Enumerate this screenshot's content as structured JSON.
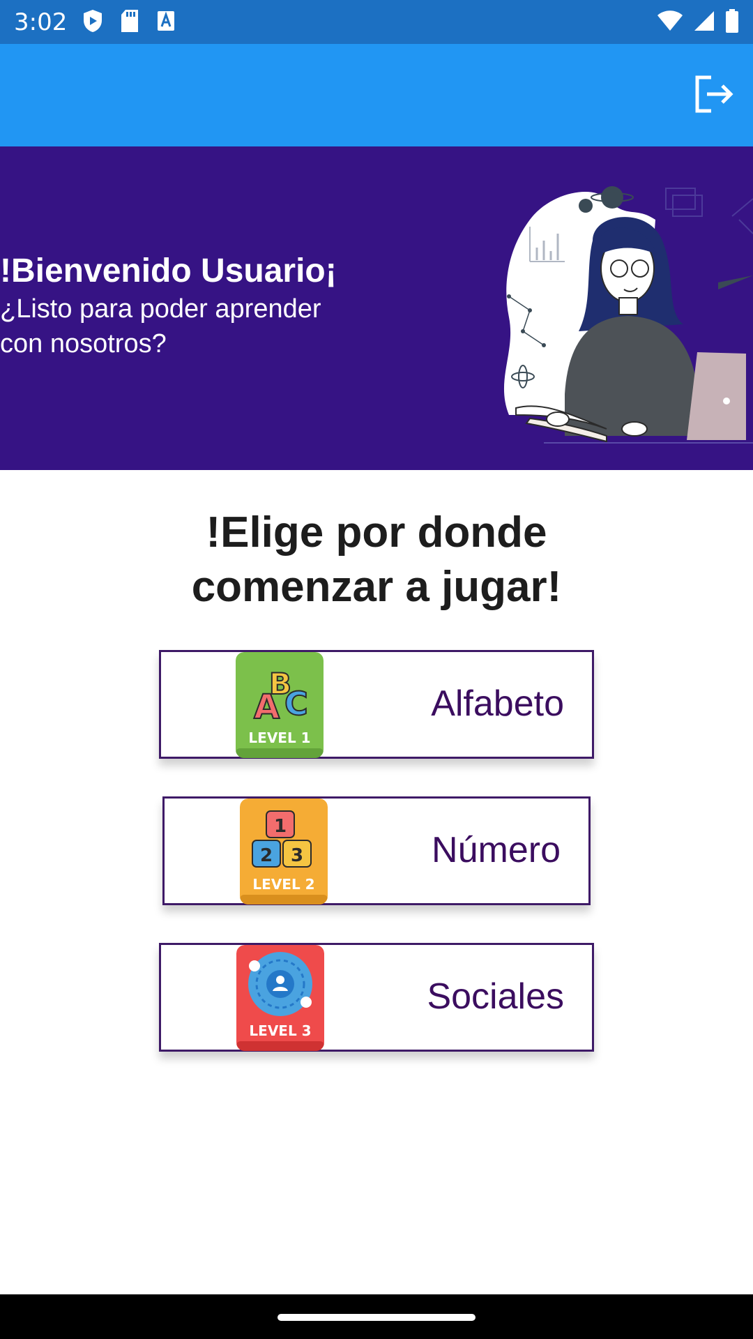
{
  "status_bar": {
    "time": "3:02",
    "left_icons": [
      "play-protect-icon",
      "sd-card-icon",
      "text-a-icon"
    ],
    "right_icons": [
      "wifi-icon",
      "signal-icon",
      "battery-icon"
    ]
  },
  "app_bar": {
    "color": "#2196f3",
    "action_icon": "logout-icon"
  },
  "banner": {
    "title": "!Bienvenido Usuario¡",
    "subtitle": "¿Listo para poder aprender con nosotros?",
    "background": "#361384"
  },
  "heading": {
    "line1": "!Elige por donde",
    "line2": "comenzar a jugar!"
  },
  "levels": [
    {
      "label": "Alfabeto",
      "badge": "LEVEL 1",
      "icon": "abc-blocks-icon",
      "color": "#7cc04b"
    },
    {
      "label": "Número",
      "badge": "LEVEL 2",
      "icon": "number-blocks-icon",
      "color": "#f5ac35"
    },
    {
      "label": "Sociales",
      "badge": "LEVEL 3",
      "icon": "social-network-icon",
      "color": "#ef4b4b"
    }
  ]
}
